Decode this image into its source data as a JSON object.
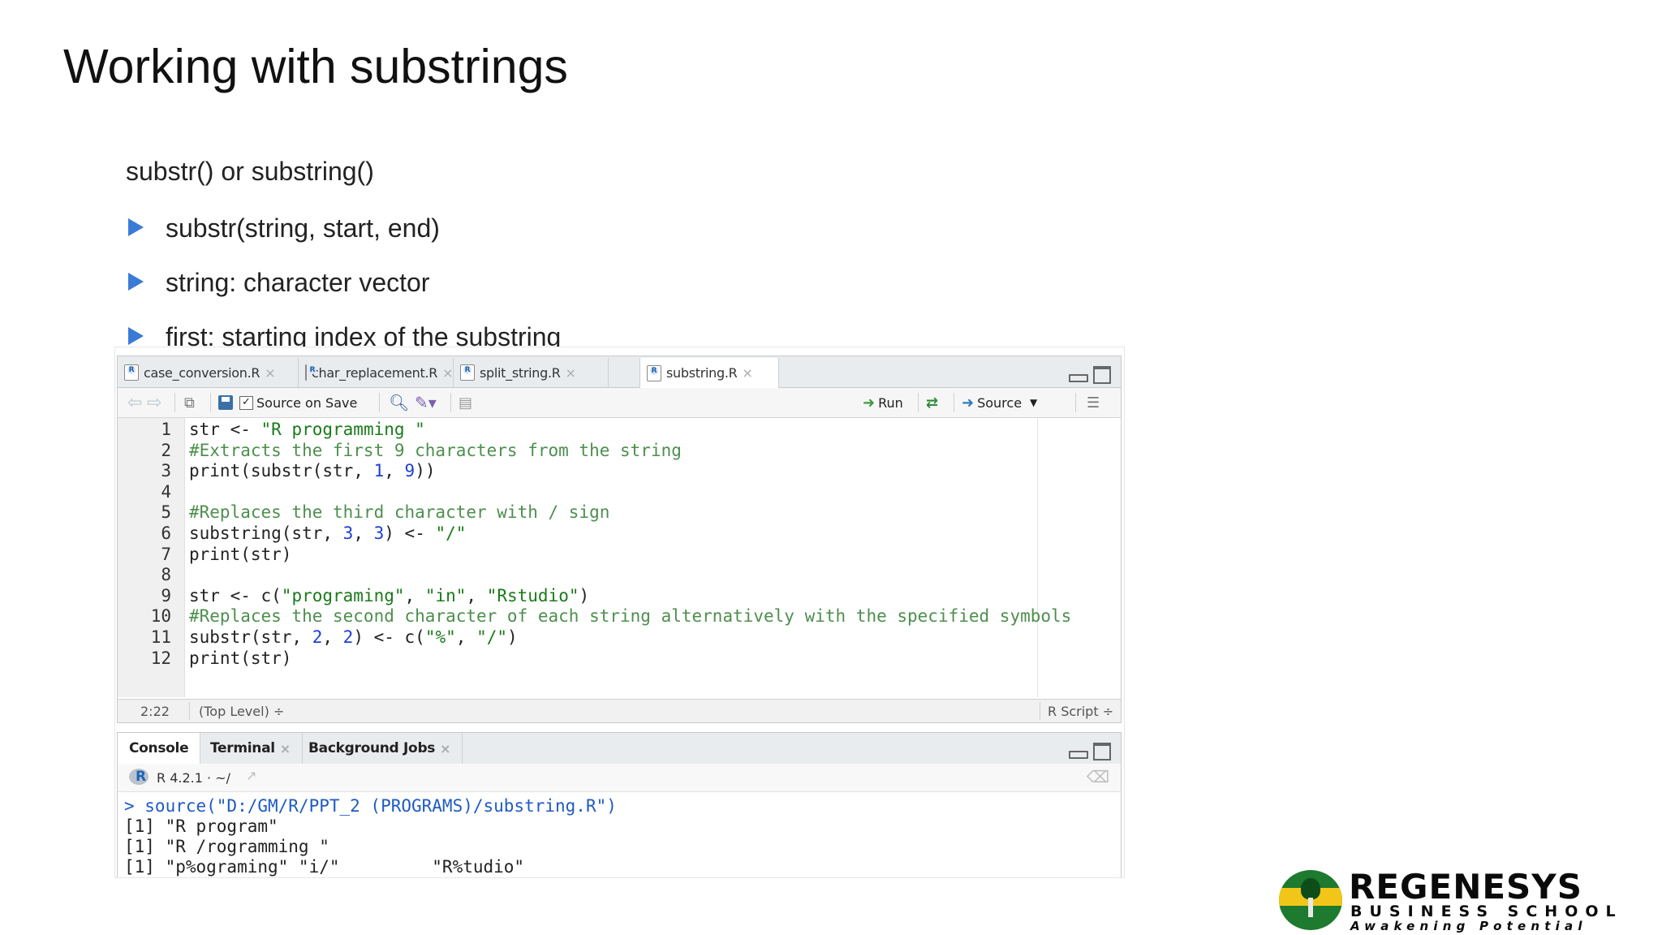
{
  "slide": {
    "title": "Working with substrings",
    "subtitle": "substr() or substring()",
    "bullets": [
      "substr(string, start, end)",
      "string: character vector",
      "first: starting index of the substring"
    ]
  },
  "editor": {
    "tabs": [
      {
        "label": "case_conversion.R"
      },
      {
        "label": "char_replacement.R"
      },
      {
        "label": "split_string.R"
      },
      {
        "label": "substring.R"
      }
    ],
    "toolbar": {
      "source_on_save": "Source on Save",
      "run": "Run",
      "source": "Source"
    },
    "code": [
      {
        "n": "1",
        "parts": [
          {
            "t": "str <- ",
            "c": ""
          },
          {
            "t": "\"R programming \"",
            "c": "str"
          }
        ]
      },
      {
        "n": "2",
        "parts": [
          {
            "t": "#Extracts the first 9 characters from the string",
            "c": "cmt"
          }
        ]
      },
      {
        "n": "3",
        "parts": [
          {
            "t": "print(substr(str, ",
            "c": ""
          },
          {
            "t": "1",
            "c": "num"
          },
          {
            "t": ", ",
            "c": ""
          },
          {
            "t": "9",
            "c": "num"
          },
          {
            "t": "))",
            "c": ""
          }
        ]
      },
      {
        "n": "4",
        "parts": []
      },
      {
        "n": "5",
        "parts": [
          {
            "t": "#Replaces the third character with / sign",
            "c": "cmt"
          }
        ]
      },
      {
        "n": "6",
        "parts": [
          {
            "t": "substring(str, ",
            "c": ""
          },
          {
            "t": "3",
            "c": "num"
          },
          {
            "t": ", ",
            "c": ""
          },
          {
            "t": "3",
            "c": "num"
          },
          {
            "t": ") <- ",
            "c": ""
          },
          {
            "t": "\"/\"",
            "c": "str"
          }
        ]
      },
      {
        "n": "7",
        "parts": [
          {
            "t": "print(str)",
            "c": ""
          }
        ]
      },
      {
        "n": "8",
        "parts": []
      },
      {
        "n": "9",
        "parts": [
          {
            "t": "str <- c(",
            "c": ""
          },
          {
            "t": "\"programing\"",
            "c": "str"
          },
          {
            "t": ", ",
            "c": ""
          },
          {
            "t": "\"in\"",
            "c": "str"
          },
          {
            "t": ", ",
            "c": ""
          },
          {
            "t": "\"Rstudio\"",
            "c": "str"
          },
          {
            "t": ")",
            "c": ""
          }
        ]
      },
      {
        "n": "10",
        "parts": [
          {
            "t": "#Replaces the second character of each string alternatively with the specified symbols",
            "c": "cmt"
          }
        ]
      },
      {
        "n": "11",
        "parts": [
          {
            "t": "substr(str, ",
            "c": ""
          },
          {
            "t": "2",
            "c": "num"
          },
          {
            "t": ", ",
            "c": ""
          },
          {
            "t": "2",
            "c": "num"
          },
          {
            "t": ") <- c(",
            "c": ""
          },
          {
            "t": "\"%\"",
            "c": "str"
          },
          {
            "t": ", ",
            "c": ""
          },
          {
            "t": "\"/\"",
            "c": "str"
          },
          {
            "t": ")",
            "c": ""
          }
        ]
      },
      {
        "n": "12",
        "parts": [
          {
            "t": "print(str)",
            "c": ""
          }
        ]
      }
    ],
    "status": {
      "position": "2:22",
      "scope": "(Top Level) ÷",
      "file_type": "R Script ÷"
    }
  },
  "console": {
    "tabs": [
      {
        "label": "Console"
      },
      {
        "label": "Terminal"
      },
      {
        "label": "Background Jobs"
      }
    ],
    "path": "R 4.2.1 · ~/",
    "lines": [
      {
        "text": "> source(\"D:/GM/R/PPT_2 (PROGRAMS)/substring.R\")",
        "cls": "cmd"
      },
      {
        "text": "[1] \"R program\"",
        "cls": ""
      },
      {
        "text": "[1] \"R /rogramming \"",
        "cls": ""
      },
      {
        "text": "[1] \"p%ograming\" \"i/\"         \"R%tudio\"",
        "cls": ""
      }
    ]
  },
  "logo": {
    "name": "REGENESYS",
    "sub": "BUSINESS SCHOOL",
    "tagline": "Awakening Potential"
  },
  "colors": {
    "bullet_arrow": "#3a7bd5",
    "code_string": "#1a7a1a",
    "code_number": "#1c3fd4",
    "code_comment": "#4d8f4d",
    "console_command": "#1f5bc4",
    "logo_green": "#1d7a2e",
    "logo_yellow": "#f2c618"
  }
}
